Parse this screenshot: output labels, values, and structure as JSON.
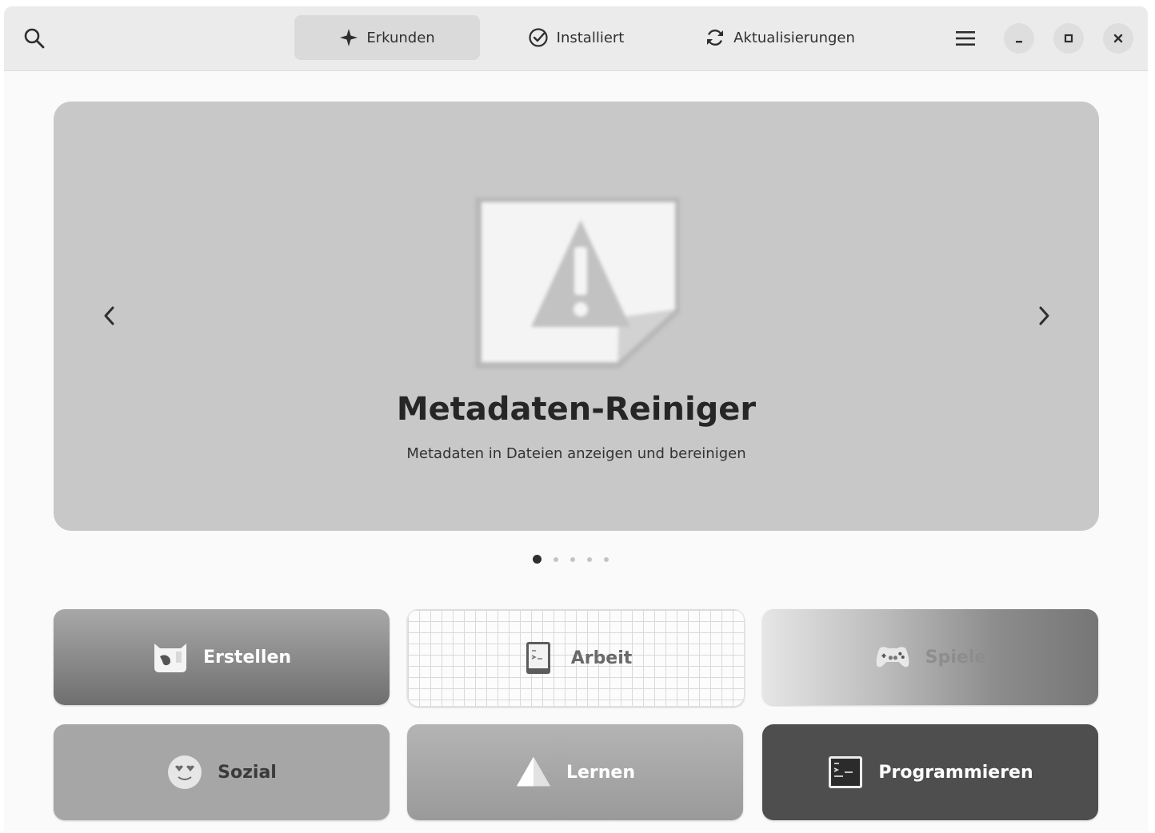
{
  "header": {
    "tabs": [
      {
        "label": "Erkunden",
        "icon": "explore-icon",
        "active": true
      },
      {
        "label": "Installiert",
        "icon": "check-circle-icon",
        "active": false
      },
      {
        "label": "Aktualisierungen",
        "icon": "refresh-icon",
        "active": false
      }
    ]
  },
  "banner": {
    "title": "Metadaten-Reiniger",
    "subtitle": "Metadaten in Dateien anzeigen und bereinigen",
    "slide_count": 5,
    "active_slide": 1
  },
  "categories": [
    {
      "label": "Erstellen",
      "icon": "create-icon"
    },
    {
      "label": "Arbeit",
      "icon": "work-icon"
    },
    {
      "label": "Spiele",
      "icon": "games-icon"
    },
    {
      "label": "Sozial",
      "icon": "social-icon"
    },
    {
      "label": "Lernen",
      "icon": "learn-icon"
    },
    {
      "label": "Programmieren",
      "icon": "terminal-icon"
    }
  ]
}
